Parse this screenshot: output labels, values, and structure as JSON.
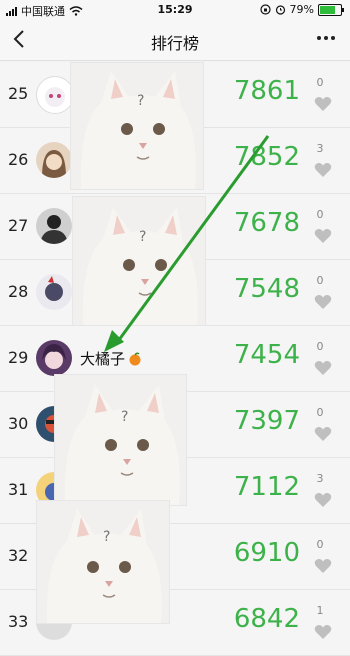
{
  "status_bar": {
    "carrier": "中国联通",
    "time": "15:29",
    "battery": "79%"
  },
  "nav": {
    "title": "排行榜",
    "back_icon": "chevron-left-icon",
    "more_icon": "more-dots-icon"
  },
  "colors": {
    "score": "#3eb24a",
    "arrow": "#2a9c2f",
    "heart": "#bfbfbf"
  },
  "rows": [
    {
      "rank": "25",
      "name": "",
      "score": "7861",
      "likes": "0"
    },
    {
      "rank": "26",
      "name": "",
      "score": "7852",
      "likes": "3"
    },
    {
      "rank": "27",
      "name": "",
      "score": "7678",
      "likes": "0"
    },
    {
      "rank": "28",
      "name": "",
      "score": "7548",
      "likes": "0"
    },
    {
      "rank": "29",
      "name": "大橘子",
      "score": "7454",
      "likes": "0"
    },
    {
      "rank": "30",
      "name": "",
      "score": "7397",
      "likes": "0"
    },
    {
      "rank": "31",
      "name": "",
      "score": "7112",
      "likes": "3"
    },
    {
      "rank": "32",
      "name": "",
      "score": "6910",
      "likes": "0"
    },
    {
      "rank": "33",
      "name": "",
      "score": "6842",
      "likes": "1"
    }
  ]
}
